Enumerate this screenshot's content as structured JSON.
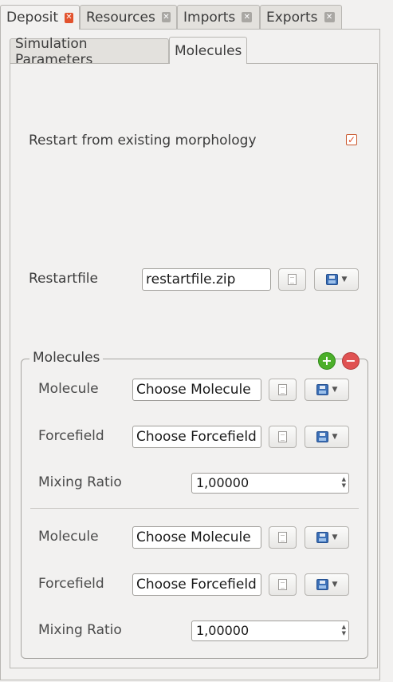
{
  "tabs": [
    {
      "label": "Deposit"
    },
    {
      "label": "Resources"
    },
    {
      "label": "Imports"
    },
    {
      "label": "Exports"
    }
  ],
  "subtabs": [
    {
      "label": "Simulation Parameters"
    },
    {
      "label": "Molecules"
    }
  ],
  "restart": {
    "label": "Restart from existing morphology",
    "checked": true
  },
  "restartfile": {
    "label": "Restartfile",
    "value": "restartfile.zip"
  },
  "molecules_group": {
    "title": "Molecules",
    "entries": [
      {
        "molecule_label": "Molecule",
        "molecule_value": "Choose Molecule",
        "forcefield_label": "Forcefield",
        "forcefield_value": "Choose Forcefield",
        "ratio_label": "Mixing Ratio",
        "ratio_value": "1,00000"
      },
      {
        "molecule_label": "Molecule",
        "molecule_value": "Choose Molecule",
        "forcefield_label": "Forcefield",
        "forcefield_value": "Choose Forcefield",
        "ratio_label": "Mixing Ratio",
        "ratio_value": "1,00000"
      }
    ]
  },
  "colors": {
    "accent": "#e2522d",
    "add": "#4caf2a",
    "remove": "#e05252"
  }
}
